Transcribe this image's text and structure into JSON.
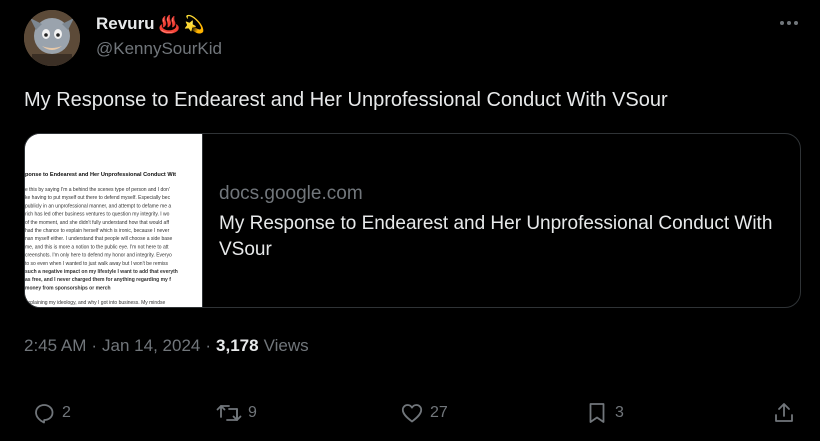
{
  "user": {
    "display_name": "Revuru",
    "emojis": [
      "♨️",
      "💫"
    ],
    "handle": "@KennySourKid",
    "avatar_icon": "avatar-image"
  },
  "tweet": {
    "text": "My Response to Endearest and Her Unprofessional Conduct With VSour",
    "time": "2:45 AM",
    "date": "Jan 14, 2024",
    "separator": "·",
    "views": "3,178",
    "views_label": "Views"
  },
  "card": {
    "domain": "docs.google.com",
    "title": "My Response to Endearest and Her Unprofessional Conduct With VSour",
    "thumbnail": {
      "heading": "ponse to Endearest and Her Unprofessional Conduct Wit",
      "lines": [
        "e this by saying I'm a behind the scenes type of person and I don'",
        "ke having to put myself out there to defend myself. Especially bec",
        "publicly in an unprofessional manner, and attempt to defame me a",
        "rich has led other business ventures to question my integrity. I wo",
        "of the moment, and she didn't fully understand how that would aff",
        "had the chance to explain herself which is ironic, because I never",
        "nan myself either. I understand that people will choose a side base",
        "me, and this is more a notion to the public eye. I'm not here to att",
        "creenshots. I'm only here to defend my honor and integrity. Everyo",
        "to so even when I wanted to just walk away but I won't be remiss",
        "such a negative impact on my lifestyle I want to add that everyth",
        "as free, and I never charged them for anything regarding my f",
        "money from sponsorships or merch"
      ],
      "footer": "explaining my ideology, and why I got into business. My mindse"
    }
  },
  "actions": {
    "replies": "2",
    "reposts": "9",
    "likes": "27",
    "bookmarks": "3"
  },
  "colors": {
    "background": "#000000",
    "text": "#e7e9ea",
    "muted": "#71767b",
    "border": "#2f3336"
  }
}
